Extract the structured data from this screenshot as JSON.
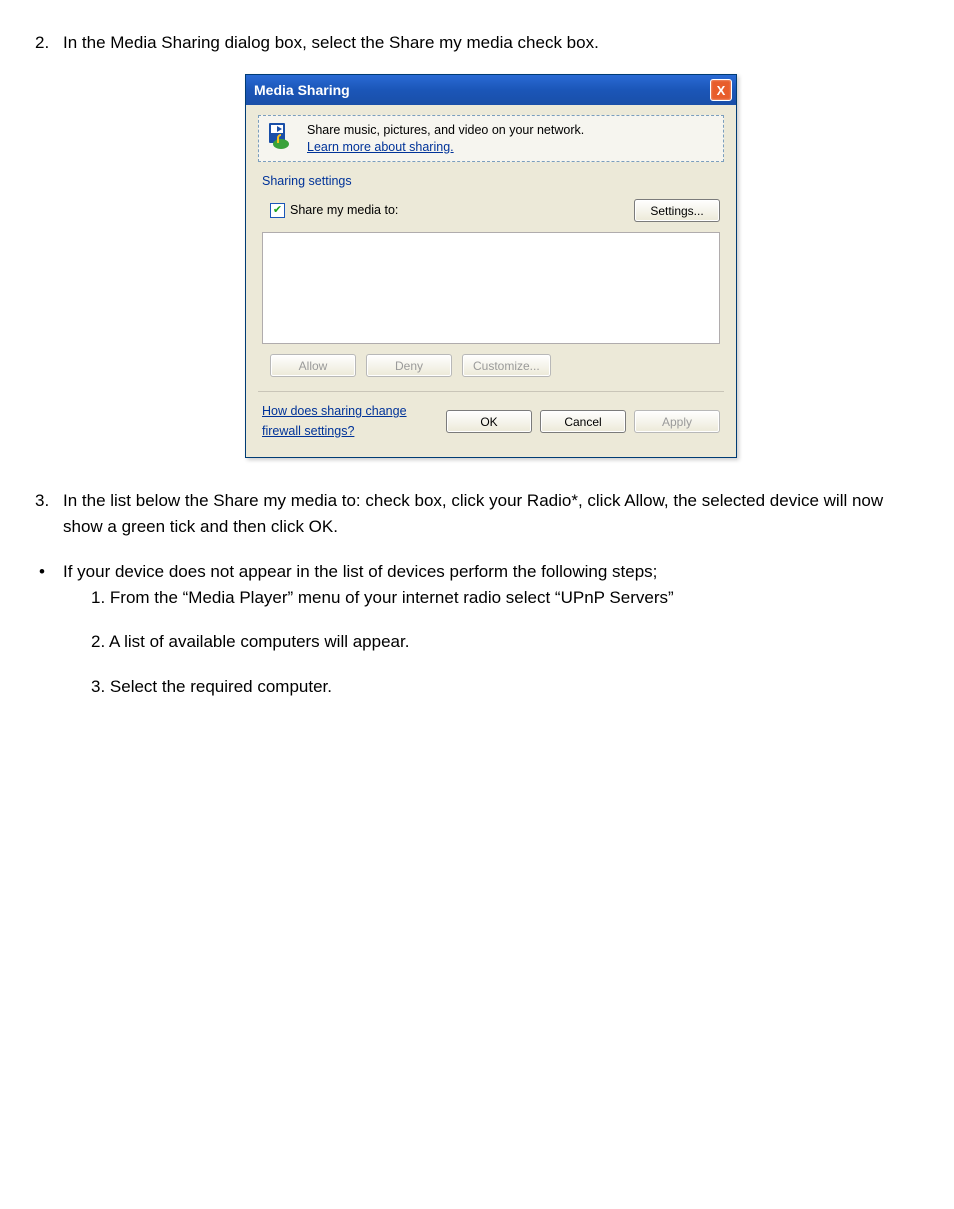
{
  "steps": {
    "s2_num": "2.",
    "s2_text": "In the Media Sharing dialog box, select the Share my media check box.",
    "s3_num": "3.",
    "s3_text": "In the list below the Share my media to: check box, click your Radio*, click Allow, the selected device will now show a green tick and then click OK.",
    "bullet_text": "If your device does not appear in the list of devices perform the following steps;",
    "substeps": {
      "a": "1. From the “Media Player” menu of your internet radio select “UPnP Servers”",
      "b": "2. A list of available computers will appear.",
      "c": "3. Select the required computer."
    }
  },
  "dialog": {
    "title": "Media Sharing",
    "close_x": "X",
    "intro_line1": "Share music, pictures, and video on your network.",
    "intro_link": "Learn more about sharing.",
    "group_label": "Sharing settings",
    "share_label": "Share my media to:",
    "settings_btn": "Settings...",
    "allow_btn": "Allow",
    "deny_btn": "Deny",
    "customize_btn": "Customize...",
    "firewall_link": "How does sharing change firewall settings?",
    "ok_btn": "OK",
    "cancel_btn": "Cancel",
    "apply_btn": "Apply"
  }
}
